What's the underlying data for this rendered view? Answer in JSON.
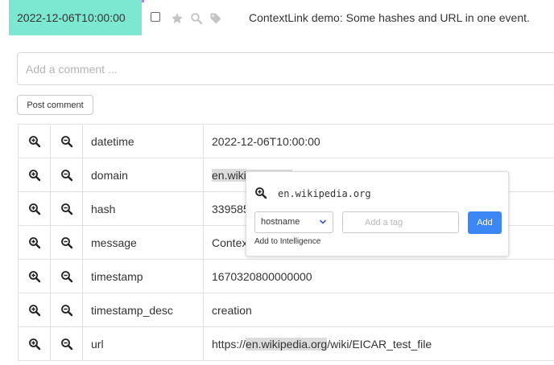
{
  "event": {
    "datetime": "2022-12-06T10:00:00",
    "message": "ContextLink demo: Some hashes and URL in one event."
  },
  "comment": {
    "placeholder": "Add a comment ...",
    "post_label": "Post comment"
  },
  "attributes": [
    {
      "name": "datetime",
      "value": "2022-12-06T10:00:00"
    },
    {
      "name": "domain",
      "value_prefix": "",
      "value_highlight": "en.wiki",
      "value_suffix": "",
      "value_tail_highlight": ""
    },
    {
      "name": "hash",
      "value": "339585"
    },
    {
      "name": "message",
      "value": "Contex"
    },
    {
      "name": "timestamp",
      "value": "1670320800000000"
    },
    {
      "name": "timestamp_desc",
      "value": "creation"
    },
    {
      "name": "url",
      "value_prefix": "https://",
      "value_highlight": "en.wikipedia.org",
      "value_suffix": "/wiki/EICAR_test_file"
    }
  ],
  "popover": {
    "title": "en.wikipedia.org",
    "type_selected": "hostname",
    "tag_placeholder": "Add a tag",
    "add_label": "Add",
    "intel_label": "Add to Intelligence"
  },
  "icons": {
    "filter_in": "zoom-in-icon",
    "filter_out": "zoom-out-icon",
    "star": "star-icon",
    "search": "search-icon",
    "tag": "tag-icon"
  },
  "colors": {
    "timestamp_bg": "#7de8d2",
    "accent_purple": "#b57fe0",
    "add_button": "#3d87f5",
    "highlight": "#dcdcdc"
  }
}
